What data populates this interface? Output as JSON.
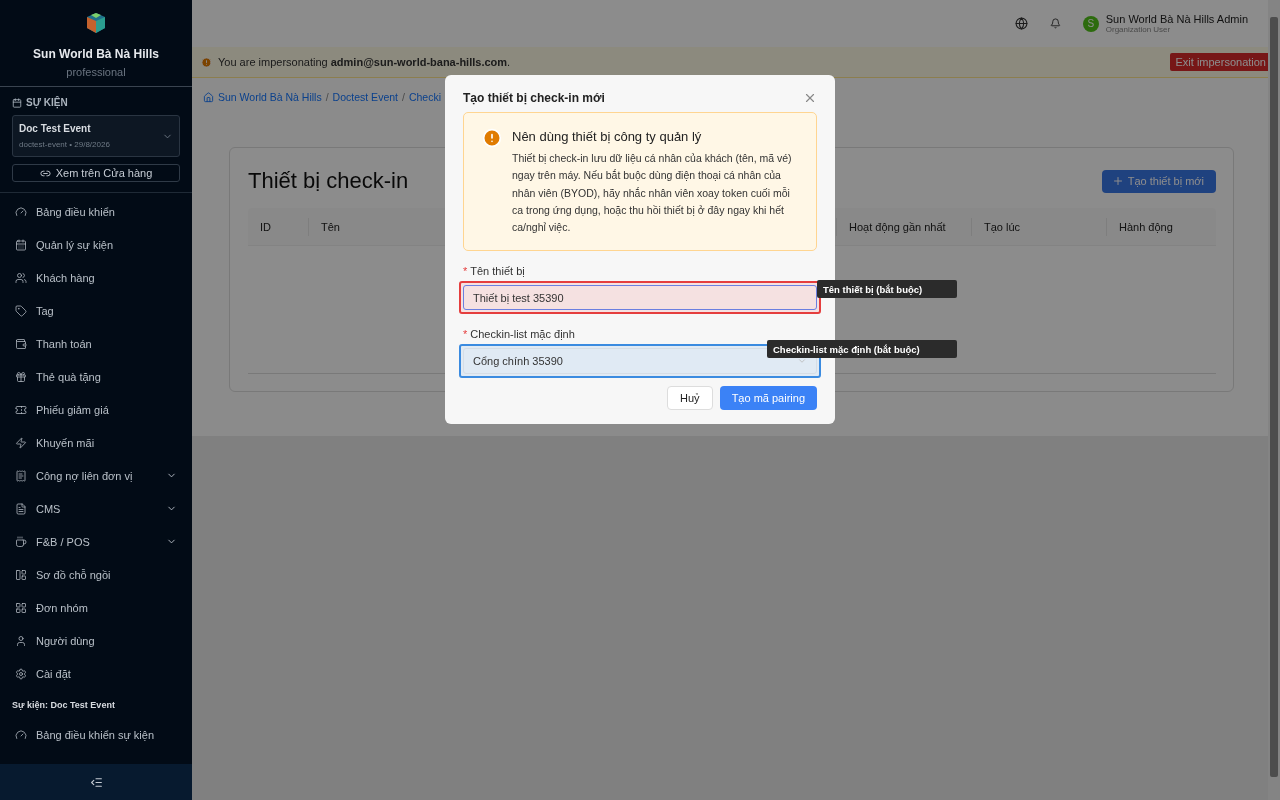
{
  "sidebar": {
    "brand": "Sun World Bà Nà Hills",
    "plan": "professional",
    "section_label": "SỰ KIỆN",
    "event": {
      "name": "Doc Test Event",
      "meta": "doctest-event • 29/8/2026"
    },
    "store_link": "Xem trên Cửa hàng",
    "items": [
      {
        "label": "Bảng điều khiển",
        "expandable": false
      },
      {
        "label": "Quản lý sự kiện",
        "expandable": false
      },
      {
        "label": "Khách hàng",
        "expandable": false
      },
      {
        "label": "Tag",
        "expandable": false
      },
      {
        "label": "Thanh toán",
        "expandable": false
      },
      {
        "label": "Thẻ quà tặng",
        "expandable": false
      },
      {
        "label": "Phiếu giảm giá",
        "expandable": false
      },
      {
        "label": "Khuyến mãi",
        "expandable": false
      },
      {
        "label": "Công nợ liên đơn vị",
        "expandable": true
      },
      {
        "label": "CMS",
        "expandable": true
      },
      {
        "label": "F&B / POS",
        "expandable": true
      },
      {
        "label": "Sơ đồ chỗ ngồi",
        "expandable": false
      },
      {
        "label": "Đơn nhóm",
        "expandable": false
      },
      {
        "label": "Người dùng",
        "expandable": false
      },
      {
        "label": "Cài đặt",
        "expandable": false
      }
    ],
    "event_section": "Sự kiện: Doc Test Event",
    "event_items": [
      {
        "label": "Bảng điều khiển sự kiện",
        "expandable": false
      }
    ]
  },
  "header": {
    "user": {
      "initial": "S",
      "name": "Sun World Bà Nà Hills Admin",
      "role": "Organization User"
    }
  },
  "impersonation": {
    "text": "You are impersonating **admin@sun-world-bana-hills.com**.",
    "button": "Exit impersonation"
  },
  "breadcrumb": [
    {
      "kind": "link",
      "text": "Sun World Bà Nà Hills"
    },
    {
      "kind": "separator",
      "text": "/"
    },
    {
      "kind": "link",
      "text": "Doctest Event"
    },
    {
      "kind": "separator",
      "text": "/"
    },
    {
      "kind": "link",
      "text": "Checki"
    }
  ],
  "page": {
    "title": "Thiết bị check-in",
    "new_button": "Tạo thiết bị mới",
    "columns": [
      {
        "label": "ID"
      },
      {
        "label": "Tên"
      },
      {
        "label": "Hoạt động gần nhất"
      },
      {
        "label": "Tạo lúc"
      },
      {
        "label": "Hành động"
      }
    ]
  },
  "dialog": {
    "title": "Tạo thiết bị check-in mới",
    "alert": {
      "title": "Nên dùng thiết bị công ty quản lý",
      "text": "Thiết bị check-in lưu dữ liệu cá nhân của khách (tên, mã vé) ngay trên máy. Nếu bắt buộc dùng điện thoại cá nhân của nhân viên (BYOD), hãy nhắc nhân viên xoay token cuối mỗi ca trong ứng dụng, hoặc thu hồi thiết bị ở đây ngay khi hết ca/nghỉ việc."
    },
    "fields": [
      {
        "kind": "text",
        "label": "Tên thiết bị",
        "required_mark": "*",
        "value": "Thiết bị test 35390",
        "color": "#e53e3e",
        "tooltip": "Tên thiết bị (bắt buộc)"
      },
      {
        "kind": "select",
        "label": "Checkin-list mặc định",
        "required_mark": "*",
        "value": "Cổng chính 35390",
        "color": "#3b8be0",
        "tooltip": "Checkin-list mặc định (bắt buộc)"
      }
    ],
    "buttons": [
      {
        "label": "Huỷ",
        "kind": "secondary"
      },
      {
        "label": "Tạo mã pairing",
        "kind": "primary"
      }
    ]
  }
}
